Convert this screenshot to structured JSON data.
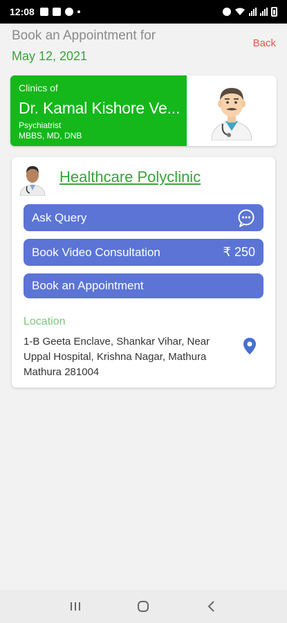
{
  "status_bar": {
    "time": "12:08"
  },
  "header": {
    "title": "Book an Appointment for",
    "date": "May 12, 2021",
    "back_label": "Back"
  },
  "doctor": {
    "clinics_of_label": "Clinics of",
    "name": "Dr. Kamal Kishore Ve...",
    "specialty": "Psychiatrist",
    "degrees": "MBBS, MD, DNB"
  },
  "clinic": {
    "name": "Healthcare Polyclinic",
    "ask_query_label": "Ask Query",
    "video_consult_label": "Book Video Consultation",
    "video_consult_price": "₹ 250",
    "book_appointment_label": "Book an Appointment",
    "location_label": "Location",
    "address": "1-B Geeta Enclave,  Shankar Vihar,  Near Uppal Hospital,  Krishna Nagar,  Mathura Mathura 281004"
  },
  "colors": {
    "banner_green": "#14b81a",
    "accent_green": "#3aa23a",
    "button_blue": "#5b74d6",
    "back_red": "#e05a4a"
  },
  "icons": {
    "chat": "chat-bubble-icon",
    "location": "location-pin-icon"
  }
}
